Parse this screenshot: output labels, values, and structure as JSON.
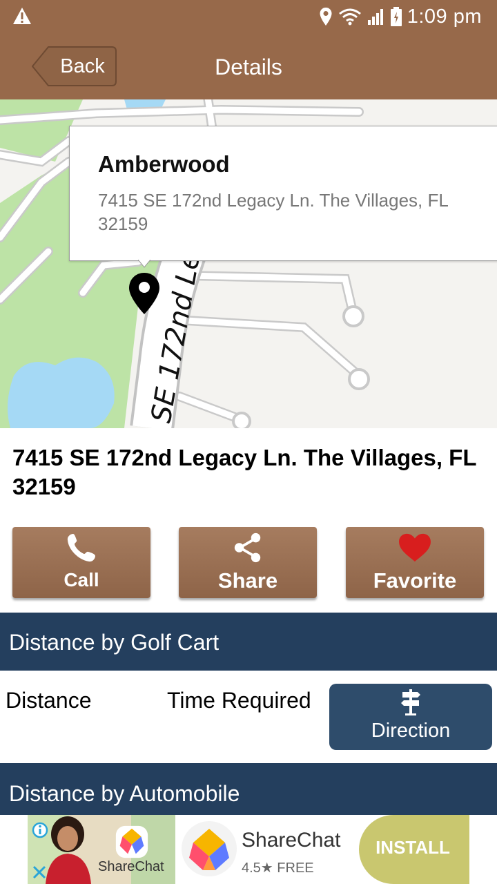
{
  "status_bar": {
    "time": "1:09 pm",
    "icons": [
      "warning-icon",
      "location-icon",
      "wifi-icon",
      "signal-icon",
      "battery-icon"
    ]
  },
  "nav": {
    "back_label": "Back",
    "title": "Details"
  },
  "map": {
    "info_window": {
      "name": "Amberwood",
      "address": "7415 SE 172nd Legacy Ln. The Villages, FL 32159"
    },
    "street_label": "SE 172nd Le"
  },
  "address_heading": "7415 SE 172nd Legacy Ln. The Villages, FL 32159",
  "actions": [
    {
      "label": "Call",
      "icon": "phone-icon"
    },
    {
      "label": "Share",
      "icon": "share-icon"
    },
    {
      "label": "Favorite",
      "icon": "heart-icon"
    }
  ],
  "sections": {
    "golf_cart": {
      "title": "Distance by Golf Cart",
      "distance_label": "Distance",
      "time_label": "Time Required",
      "direction_label": "Direction"
    },
    "automobile": {
      "title": "Distance by Automobile"
    }
  },
  "ad": {
    "brand_small": "ShareChat",
    "app_name": "ShareChat",
    "rating": "4.5★ FREE",
    "install_label": "INSTALL"
  },
  "colors": {
    "header_brown": "#97694a",
    "button_brown": "#9a7054",
    "section_navy": "#243f5e",
    "direction_navy": "#2e4c6b",
    "favorite_red": "#d81e1e",
    "install_green": "#c9c76f"
  }
}
